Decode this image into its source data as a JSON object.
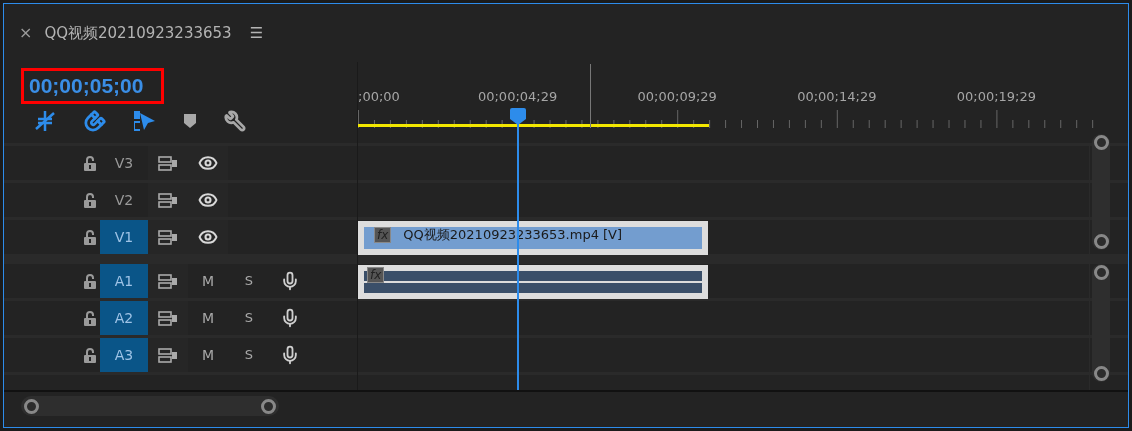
{
  "panel": {
    "close": "×",
    "title": "QQ视频20210923233653",
    "menu": "☰"
  },
  "timecode": "00;00;05;00",
  "ruler": {
    "labels": [
      ";00;00",
      "00;00;04;29",
      "00;00;09;29",
      "00;00;14;29",
      "00;00;19;29"
    ]
  },
  "tracks": [
    {
      "kind": "video",
      "name": "V3",
      "targeted": false
    },
    {
      "kind": "video",
      "name": "V2",
      "targeted": false
    },
    {
      "kind": "video",
      "name": "V1",
      "targeted": true,
      "clip": {
        "kind": "video",
        "fx": "fx",
        "name": "QQ视频20210923233653.mp4 [V]"
      }
    },
    {
      "kind": "audio",
      "name": "A1",
      "targeted": true,
      "mute": "M",
      "solo": "S",
      "clip": {
        "kind": "audio",
        "fx": "fx"
      }
    },
    {
      "kind": "audio",
      "name": "A2",
      "targeted": true,
      "mute": "M",
      "solo": "S"
    },
    {
      "kind": "audio",
      "name": "A3",
      "targeted": true,
      "mute": "M",
      "solo": "S"
    }
  ]
}
